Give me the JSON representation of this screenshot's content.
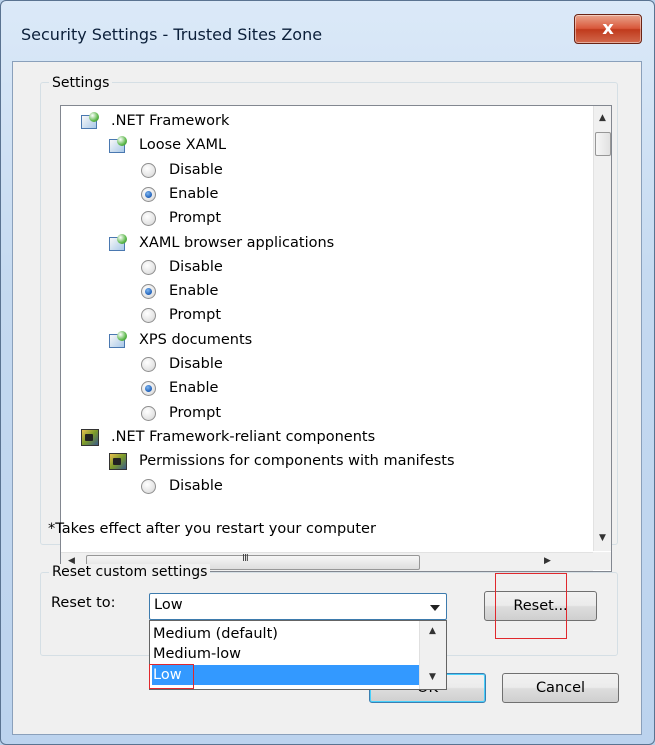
{
  "window": {
    "title": "Security Settings - Trusted Sites Zone",
    "close_label": "x"
  },
  "settings": {
    "group_label": "Settings",
    "items": [
      {
        "kind": "category",
        "icon": "net-settings-icon",
        "label": ".NET Framework"
      },
      {
        "kind": "setting",
        "icon": "net-settings-icon",
        "label": "Loose XAML"
      },
      {
        "kind": "option",
        "label": "Disable",
        "checked": false
      },
      {
        "kind": "option",
        "label": "Enable",
        "checked": true
      },
      {
        "kind": "option",
        "label": "Prompt",
        "checked": false
      },
      {
        "kind": "setting",
        "icon": "net-settings-icon",
        "label": "XAML browser applications"
      },
      {
        "kind": "option",
        "label": "Disable",
        "checked": false
      },
      {
        "kind": "option",
        "label": "Enable",
        "checked": true
      },
      {
        "kind": "option",
        "label": "Prompt",
        "checked": false
      },
      {
        "kind": "setting",
        "icon": "net-settings-icon",
        "label": "XPS documents"
      },
      {
        "kind": "option",
        "label": "Disable",
        "checked": false
      },
      {
        "kind": "option",
        "label": "Enable",
        "checked": true
      },
      {
        "kind": "option",
        "label": "Prompt",
        "checked": false
      },
      {
        "kind": "category",
        "icon": "components-icon",
        "label": ".NET Framework-reliant components"
      },
      {
        "kind": "setting",
        "icon": "components-icon",
        "label": "Permissions for components with manifests"
      },
      {
        "kind": "option",
        "label": "Disable",
        "checked": false
      }
    ],
    "hscroll_grip": "III",
    "note": "*Takes effect after you restart your computer"
  },
  "reset": {
    "group_label": "Reset custom settings",
    "reset_to_label": "Reset to:",
    "selected_value": "Low",
    "options": [
      "Medium (default)",
      "Medium-low",
      "Low"
    ],
    "selected_index": 2,
    "reset_button": "Reset..."
  },
  "footer": {
    "ok_label": "OK",
    "cancel_label": "Cancel"
  },
  "colors": {
    "highlight": "#3399ff",
    "annotation_red": "#e0282d"
  }
}
